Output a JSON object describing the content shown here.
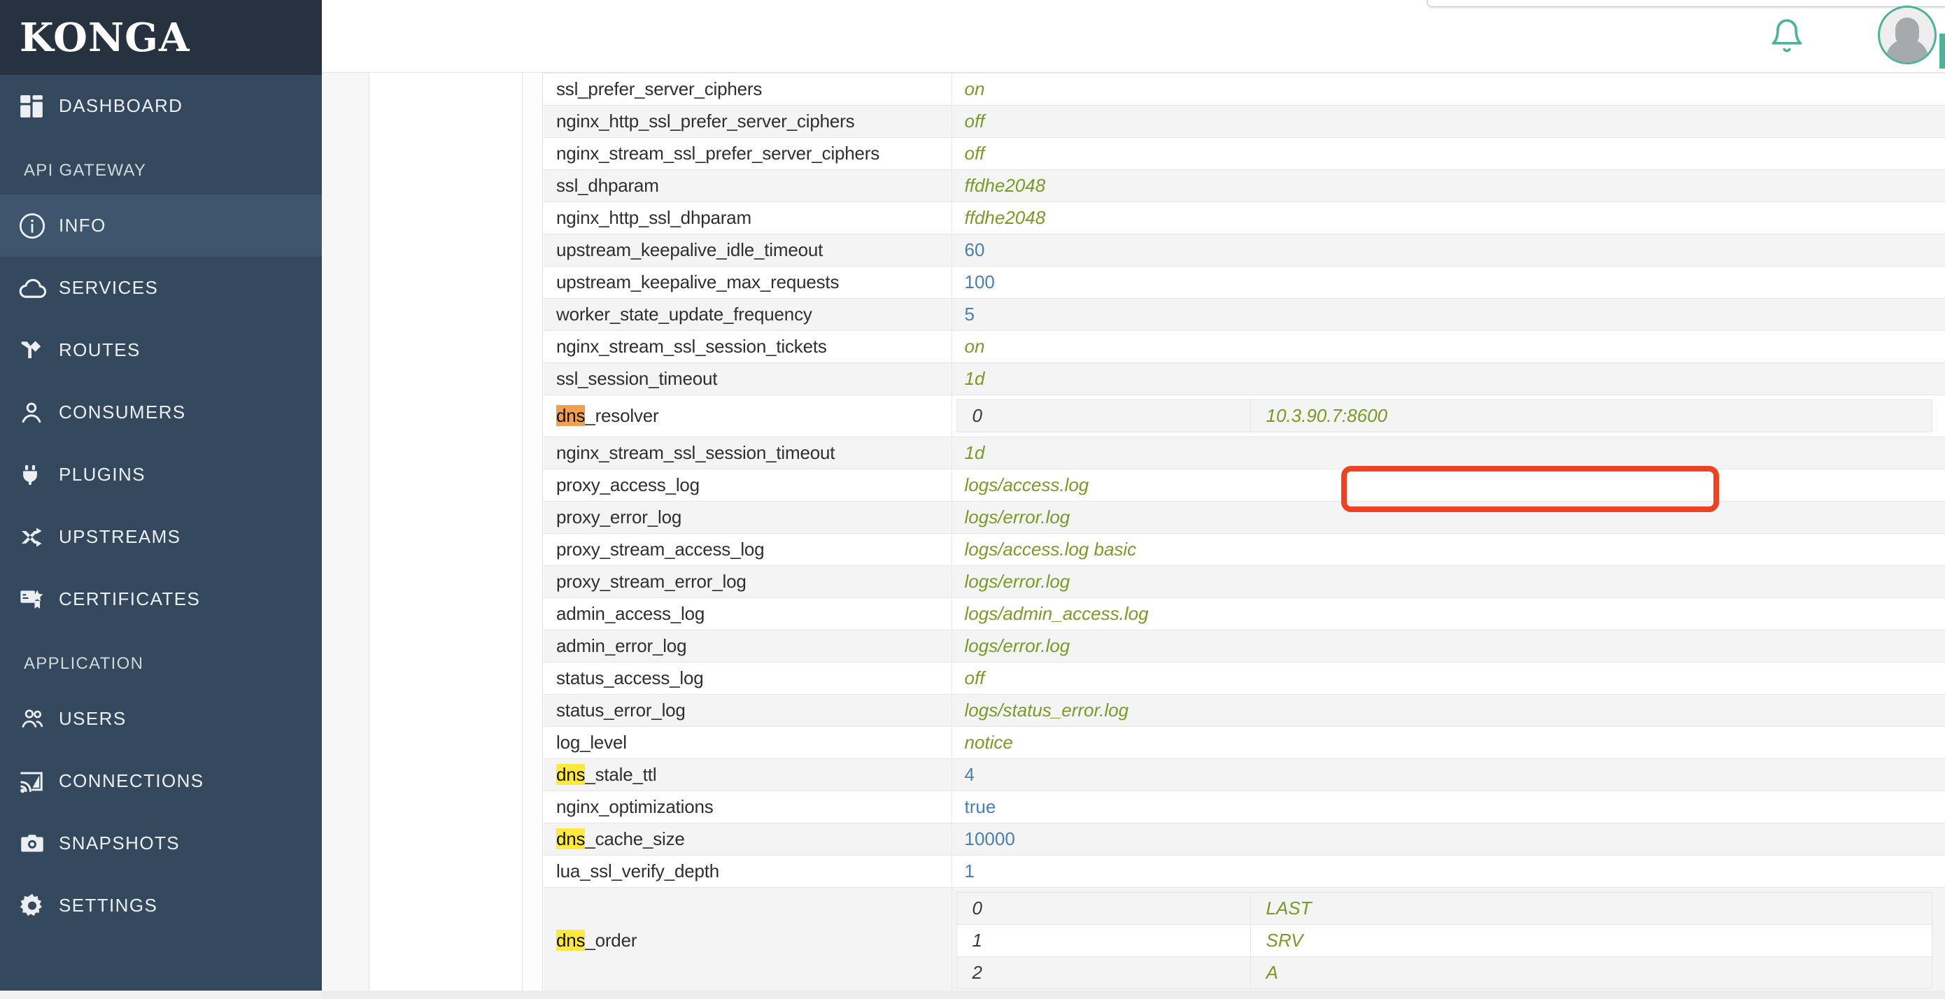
{
  "brand": {
    "logo": "KONGA"
  },
  "sidebar": {
    "groups": [
      {
        "label": "",
        "items": [
          {
            "label": "DASHBOARD",
            "icon": "dashboard-icon",
            "active": false
          }
        ]
      },
      {
        "label": "API GATEWAY",
        "items": [
          {
            "label": "INFO",
            "icon": "info-icon",
            "active": true
          },
          {
            "label": "SERVICES",
            "icon": "cloud-icon",
            "active": false
          },
          {
            "label": "ROUTES",
            "icon": "route-icon",
            "active": false
          },
          {
            "label": "CONSUMERS",
            "icon": "person-icon",
            "active": false
          },
          {
            "label": "PLUGINS",
            "icon": "plug-icon",
            "active": false
          },
          {
            "label": "UPSTREAMS",
            "icon": "shuffle-icon",
            "active": false
          },
          {
            "label": "CERTIFICATES",
            "icon": "certificate-icon",
            "active": false
          }
        ]
      },
      {
        "label": "APPLICATION",
        "items": [
          {
            "label": "USERS",
            "icon": "people-icon",
            "active": false
          },
          {
            "label": "CONNECTIONS",
            "icon": "cast-icon",
            "active": false
          },
          {
            "label": "SNAPSHOTS",
            "icon": "camera-icon",
            "active": false
          },
          {
            "label": "SETTINGS",
            "icon": "gear-icon",
            "active": false
          }
        ]
      }
    ]
  },
  "topbar": {
    "notifications_icon": "bell-icon",
    "avatar_icon": "user-avatar"
  },
  "colors": {
    "sidebar_bg": "#34495e",
    "sidebar_brand_bg": "#26323f",
    "sidebar_active_bg": "#3d566e",
    "accent_green": "#4db396",
    "value_string": "#7a9a26",
    "value_number": "#4a7fb5",
    "highlight": "#ffe93f",
    "highlight_active": "#f0a04f",
    "annotation_red": "#ee4323"
  },
  "search": {
    "term": "dns",
    "active_match_row": "dns_resolver"
  },
  "table": {
    "rows": [
      {
        "key": "ssl_prefer_server_ciphers",
        "type": "string",
        "value": "on"
      },
      {
        "key": "nginx_http_ssl_prefer_server_ciphers",
        "type": "string",
        "value": "off"
      },
      {
        "key": "nginx_stream_ssl_prefer_server_ciphers",
        "type": "string",
        "value": "off"
      },
      {
        "key": "ssl_dhparam",
        "type": "string",
        "value": "ffdhe2048"
      },
      {
        "key": "nginx_http_ssl_dhparam",
        "type": "string",
        "value": "ffdhe2048"
      },
      {
        "key": "upstream_keepalive_idle_timeout",
        "type": "number",
        "value": "60"
      },
      {
        "key": "upstream_keepalive_max_requests",
        "type": "number",
        "value": "100"
      },
      {
        "key": "worker_state_update_frequency",
        "type": "number",
        "value": "5"
      },
      {
        "key": "nginx_stream_ssl_session_tickets",
        "type": "string",
        "value": "on"
      },
      {
        "key": "ssl_session_timeout",
        "type": "string",
        "value": "1d"
      },
      {
        "key": "dns_resolver",
        "highlight": "dns",
        "active": true,
        "type": "array",
        "items": [
          {
            "index": "0",
            "value": "10.3.90.7:8600"
          }
        ]
      },
      {
        "key": "nginx_stream_ssl_session_timeout",
        "type": "string",
        "value": "1d"
      },
      {
        "key": "proxy_access_log",
        "type": "string",
        "value": "logs/access.log"
      },
      {
        "key": "proxy_error_log",
        "type": "string",
        "value": "logs/error.log"
      },
      {
        "key": "proxy_stream_access_log",
        "type": "string",
        "value": "logs/access.log basic"
      },
      {
        "key": "proxy_stream_error_log",
        "type": "string",
        "value": "logs/error.log"
      },
      {
        "key": "admin_access_log",
        "type": "string",
        "value": "logs/admin_access.log"
      },
      {
        "key": "admin_error_log",
        "type": "string",
        "value": "logs/error.log"
      },
      {
        "key": "status_access_log",
        "type": "string",
        "value": "off"
      },
      {
        "key": "status_error_log",
        "type": "string",
        "value": "logs/status_error.log"
      },
      {
        "key": "log_level",
        "type": "string",
        "value": "notice"
      },
      {
        "key": "dns_stale_ttl",
        "highlight": "dns",
        "type": "number",
        "value": "4"
      },
      {
        "key": "nginx_optimizations",
        "type": "number",
        "value": "true"
      },
      {
        "key": "dns_cache_size",
        "highlight": "dns",
        "type": "number",
        "value": "10000"
      },
      {
        "key": "lua_ssl_verify_depth",
        "type": "number",
        "value": "1"
      },
      {
        "key": "dns_order",
        "highlight": "dns",
        "type": "array",
        "items": [
          {
            "index": "0",
            "value": "LAST"
          },
          {
            "index": "1",
            "value": "SRV"
          },
          {
            "index": "2",
            "value": "A"
          }
        ]
      }
    ]
  }
}
